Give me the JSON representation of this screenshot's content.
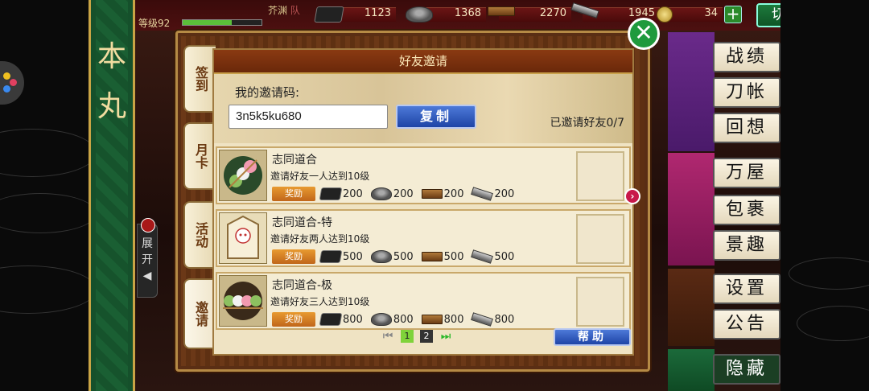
{
  "top": {
    "player_name": "芥渊",
    "team_label": "队",
    "level_label": "等级92",
    "hp_fraction": 0.62,
    "resources": [
      {
        "icon": "charcoal-icon",
        "value": "1123"
      },
      {
        "icon": "coolant-icon",
        "value": "1368"
      },
      {
        "icon": "whetstone-icon",
        "value": "2270"
      },
      {
        "icon": "steel-icon",
        "value": "1945"
      },
      {
        "icon": "koban-icon",
        "value": "34"
      }
    ],
    "plus_label": "+",
    "switch_label": "切换",
    "alert_label": "!"
  },
  "banner": {
    "title": "本丸",
    "expand_label": "展开◀"
  },
  "dialog": {
    "title": "好友邀请",
    "close_label": "✕",
    "tabs": [
      {
        "label": "签到",
        "active": false
      },
      {
        "label": "月卡",
        "active": false
      },
      {
        "label": "活动",
        "active": false
      },
      {
        "label": "邀请",
        "active": true
      }
    ],
    "invite": {
      "label": "我的邀请码:",
      "code": "3n5k5ku680",
      "copy_label": "复制",
      "invited_count": "已邀请好友0/7"
    },
    "rewards": [
      {
        "name": "志同道合",
        "desc": "邀请好友一人达到10级",
        "tag": "奖励",
        "items": [
          "200",
          "200",
          "200",
          "200"
        ]
      },
      {
        "name": "志同道合-特",
        "desc": "邀请好友两人达到10级",
        "tag": "奖励",
        "items": [
          "500",
          "500",
          "500",
          "500"
        ]
      },
      {
        "name": "志同道合-极",
        "desc": "邀请好友三人达到10级",
        "tag": "奖励",
        "items": [
          "800",
          "800",
          "800",
          "800"
        ]
      }
    ],
    "pager": {
      "first": "⏮",
      "page1": "1",
      "page2": "2",
      "last": "⏭"
    },
    "help_label": "帮助",
    "next_label": "›"
  },
  "menu": {
    "items": [
      "战绩",
      "刀帐",
      "回想",
      "万屋",
      "包裹",
      "景趣",
      "设置",
      "公告",
      "隐藏"
    ]
  }
}
